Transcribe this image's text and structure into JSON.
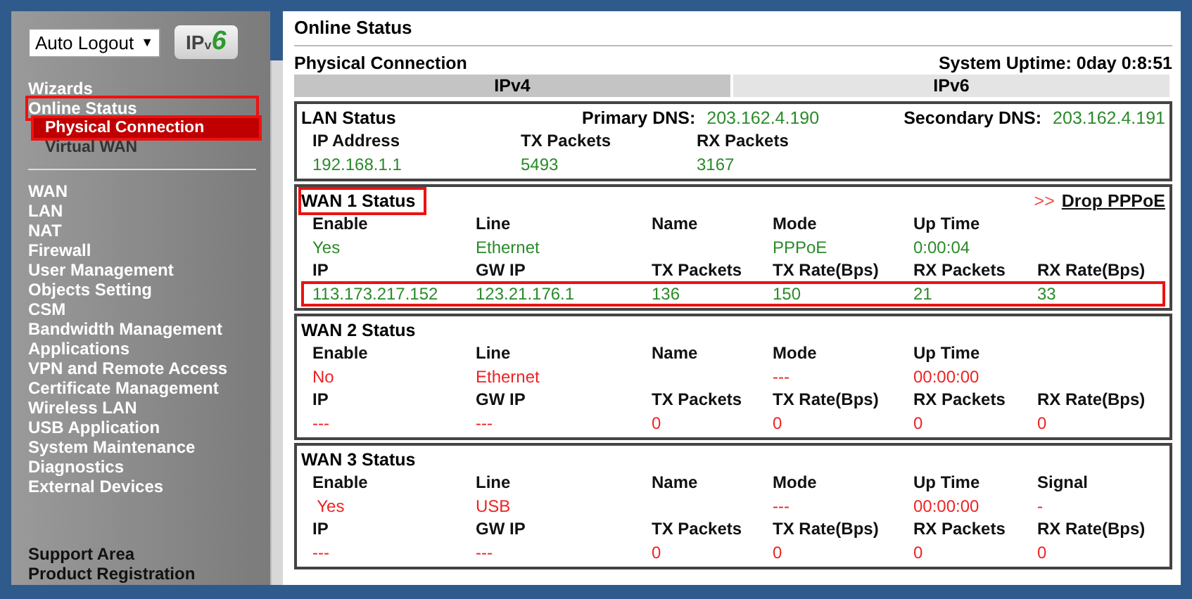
{
  "top_bar": {
    "auto_logout": {
      "label": "Auto Logout",
      "caret": "▼"
    },
    "ipv6_logo": {
      "prefix": "IP",
      "sub": "v",
      "number": "6"
    }
  },
  "sidebar": {
    "groups": [
      {
        "items": [
          {
            "label": "Wizards",
            "kind": "top",
            "selected": false,
            "annotated": false
          },
          {
            "label": "Online Status",
            "kind": "top",
            "selected": false,
            "annotated": true
          },
          {
            "label": "Physical Connection",
            "kind": "sub",
            "selected": true,
            "annotated": true
          },
          {
            "label": "Virtual WAN",
            "kind": "sub",
            "selected": false,
            "annotated": false
          }
        ]
      },
      {
        "items": [
          {
            "label": "WAN",
            "kind": "top",
            "selected": false,
            "annotated": false
          },
          {
            "label": "LAN",
            "kind": "top",
            "selected": false,
            "annotated": false
          },
          {
            "label": "NAT",
            "kind": "top",
            "selected": false,
            "annotated": false
          },
          {
            "label": "Firewall",
            "kind": "top",
            "selected": false,
            "annotated": false
          },
          {
            "label": "User Management",
            "kind": "top",
            "selected": false,
            "annotated": false
          },
          {
            "label": "Objects Setting",
            "kind": "top",
            "selected": false,
            "annotated": false
          },
          {
            "label": "CSM",
            "kind": "top",
            "selected": false,
            "annotated": false
          },
          {
            "label": "Bandwidth Management",
            "kind": "top",
            "selected": false,
            "annotated": false
          },
          {
            "label": "Applications",
            "kind": "top",
            "selected": false,
            "annotated": false
          },
          {
            "label": "VPN and Remote Access",
            "kind": "top",
            "selected": false,
            "annotated": false
          },
          {
            "label": "Certificate Management",
            "kind": "top",
            "selected": false,
            "annotated": false
          },
          {
            "label": "Wireless LAN",
            "kind": "top",
            "selected": false,
            "annotated": false
          },
          {
            "label": "USB Application",
            "kind": "top",
            "selected": false,
            "annotated": false
          },
          {
            "label": "System Maintenance",
            "kind": "top",
            "selected": false,
            "annotated": false
          },
          {
            "label": "Diagnostics",
            "kind": "top",
            "selected": false,
            "annotated": false
          },
          {
            "label": "External Devices",
            "kind": "top",
            "selected": false,
            "annotated": false
          }
        ]
      }
    ],
    "footer": [
      {
        "label": "Support Area"
      },
      {
        "label": "Product Registration"
      }
    ]
  },
  "page_title": "Online Status",
  "section": {
    "title": "Physical Connection",
    "uptime": "System Uptime: 0day 0:8:51"
  },
  "tabs": [
    {
      "label": "IPv4",
      "selected": true
    },
    {
      "label": "IPv6",
      "selected": false
    }
  ],
  "lan": {
    "title": "LAN Status",
    "primary_dns_label": "Primary DNS:",
    "primary_dns": "203.162.4.190",
    "secondary_dns_label": "Secondary DNS:",
    "secondary_dns": "203.162.4.191",
    "headers": [
      "IP Address",
      "TX Packets",
      "RX Packets"
    ],
    "values": [
      "192.168.1.1",
      "5493",
      "3167"
    ]
  },
  "wans": [
    {
      "title": "WAN 1 Status",
      "title_annotated": true,
      "action": {
        "arrows": ">>",
        "label": "Drop PPPoE"
      },
      "connected": true,
      "rows": [
        {
          "kind": "header",
          "annotated": false,
          "cells": [
            "Enable",
            "Line",
            "Name",
            "Mode",
            "Up Time",
            ""
          ]
        },
        {
          "kind": "value",
          "annotated": false,
          "cells": [
            "Yes",
            "Ethernet",
            "",
            "PPPoE",
            "0:00:04",
            ""
          ]
        },
        {
          "kind": "header",
          "annotated": false,
          "cells": [
            "IP",
            "GW IP",
            "TX Packets",
            "TX Rate(Bps)",
            "RX Packets",
            "RX Rate(Bps)"
          ]
        },
        {
          "kind": "value",
          "annotated": true,
          "cells": [
            "113.173.217.152",
            "123.21.176.1",
            "136",
            "150",
            "21",
            "33"
          ]
        }
      ]
    },
    {
      "title": "WAN 2 Status",
      "title_annotated": false,
      "connected": false,
      "rows": [
        {
          "kind": "header",
          "annotated": false,
          "cells": [
            "Enable",
            "Line",
            "Name",
            "Mode",
            "Up Time",
            ""
          ]
        },
        {
          "kind": "value",
          "annotated": false,
          "cells": [
            "No",
            "Ethernet",
            "",
            "---",
            "00:00:00",
            ""
          ]
        },
        {
          "kind": "header",
          "annotated": false,
          "cells": [
            "IP",
            "GW IP",
            "TX Packets",
            "TX Rate(Bps)",
            "RX Packets",
            "RX Rate(Bps)"
          ]
        },
        {
          "kind": "value",
          "annotated": false,
          "cells": [
            "---",
            "---",
            "0",
            "0",
            "0",
            "0"
          ]
        }
      ]
    },
    {
      "title": "WAN 3 Status",
      "title_annotated": false,
      "connected": false,
      "rows": [
        {
          "kind": "header",
          "annotated": false,
          "cells": [
            "Enable",
            "Line",
            "Name",
            "Mode",
            "Up Time",
            "Signal"
          ]
        },
        {
          "kind": "value",
          "annotated": false,
          "cells": [
            " Yes",
            "USB",
            "",
            "---",
            "00:00:00",
            "-"
          ]
        },
        {
          "kind": "header",
          "annotated": false,
          "cells": [
            "IP",
            "GW IP",
            "TX Packets",
            "TX Rate(Bps)",
            "RX Packets",
            "RX Rate(Bps)"
          ]
        },
        {
          "kind": "value",
          "annotated": false,
          "cells": [
            "---",
            "---",
            "0",
            "0",
            "0",
            "0"
          ]
        }
      ]
    }
  ]
}
